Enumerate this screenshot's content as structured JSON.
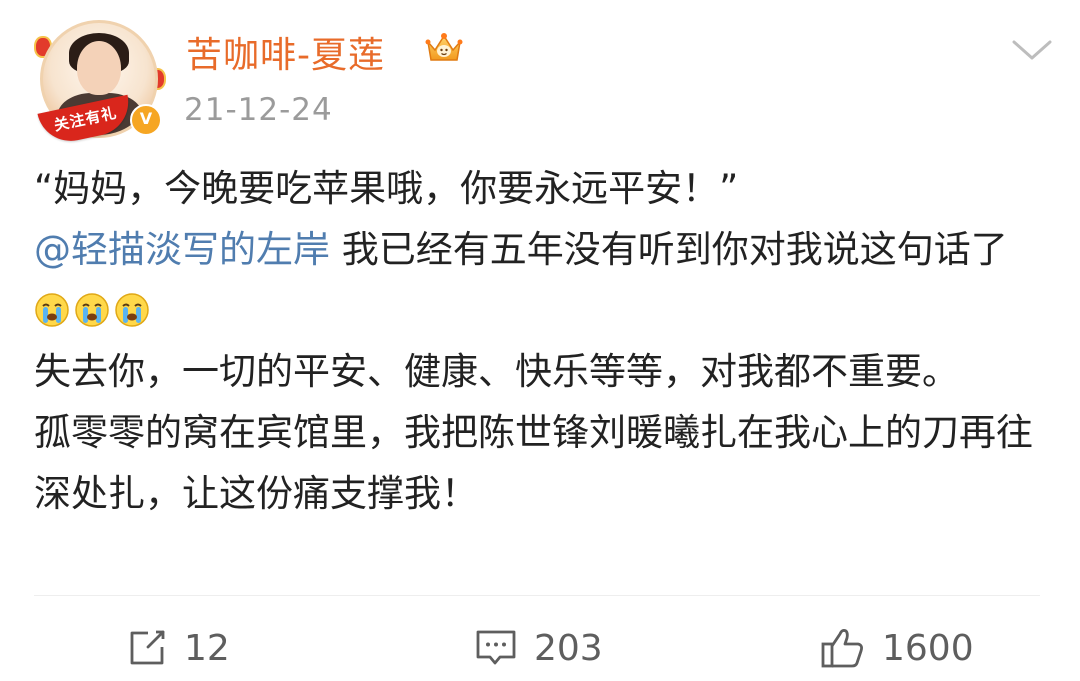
{
  "header": {
    "username": "苦咖啡-夏莲",
    "date": "21-12-24",
    "avatar_ribbon": "关注有礼",
    "verified_mark": "V",
    "username_color": "#e86b2a"
  },
  "post": {
    "line1": "“妈妈，今晚要吃苹果哦，你要永远平安！”",
    "mention": "@轻描淡写的左岸",
    "line2_after_mention": " 我已经有五年没有听到你对我说这句话了",
    "emoji_name": "crying-face-icon",
    "emoji_count": 3,
    "line3": "失去你，一切的平安、健康、快乐等等，对我都不重要。",
    "line4": "孤零零的窝在宾馆里，我把陈世锋刘暖曦扎在我心上的刀再往深处扎，让这份痛支撑我！",
    "mention_color": "#507daf"
  },
  "actions": {
    "repost_count": "12",
    "comment_count": "203",
    "like_count": "1600",
    "repost_icon": "repost-icon",
    "comment_icon": "comment-icon",
    "like_icon": "thumbs-up-icon"
  }
}
